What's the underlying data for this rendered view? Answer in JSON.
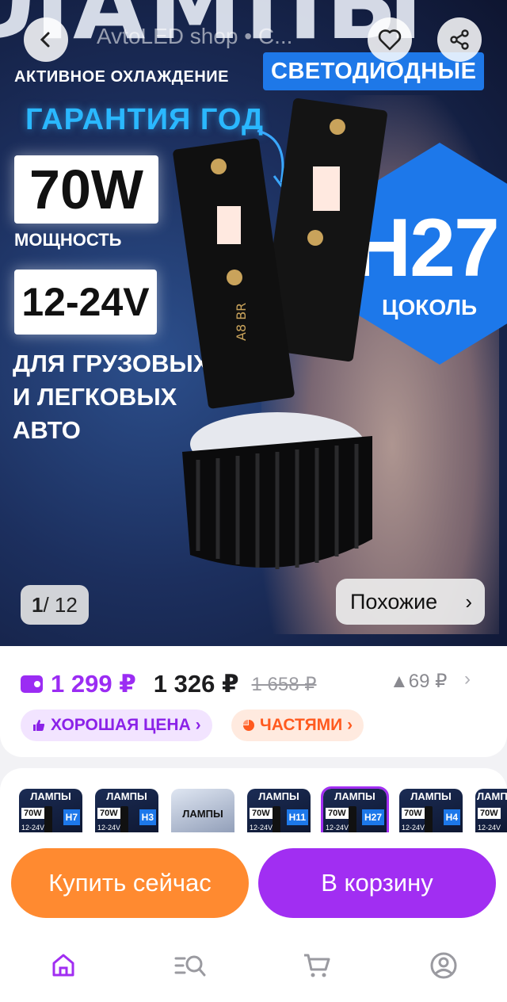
{
  "header": {
    "shop_name": "AvtoLED shop • С...",
    "back_icon": "back-arrow-icon",
    "favorite_icon": "heart-icon",
    "share_icon": "share-icon"
  },
  "hero": {
    "big_word": "ЛАМПЫ",
    "cooling": "АКТИВНОЕ ОХЛАЖДЕНИЕ",
    "led": "СВЕТОДИОДНЫЕ",
    "warranty": "ГАРАНТИЯ ГОД",
    "power_value": "70W",
    "power_label": "МОЩНОСТЬ",
    "voltage": "12-24V",
    "for_cars": "ДЛЯ ГРУЗОВЫХ И ЛЕГКОВЫХ АВТО",
    "base_code": "H27",
    "base_label": "ЦОКОЛЬ",
    "lamp_marking": "A8 BR",
    "image_index": "1",
    "image_total": "/ 12",
    "similar_label": "Похожие",
    "similar_chevron": "›"
  },
  "price": {
    "wallet_price": "1 299 ₽",
    "price": "1 326 ₽",
    "old_price": "1 658 ₽",
    "delta": "▲69 ₽",
    "chevron": "›"
  },
  "chips": {
    "good_price": "ХОРОШАЯ ЦЕНА ›",
    "installments": "ЧАСТЯМИ ›"
  },
  "variants": [
    {
      "title": "ЛАМПЫ",
      "power": "70W",
      "volt": "12-24V",
      "code": "H7"
    },
    {
      "title": "ЛАМПЫ",
      "power": "70W",
      "volt": "12-24V",
      "code": "H3"
    },
    {
      "title": "ЛАМПЫ",
      "power": "",
      "volt": "",
      "code": ""
    },
    {
      "title": "ЛАМПЫ",
      "power": "70W",
      "volt": "12-24V",
      "code": "H11"
    },
    {
      "title": "ЛАМПЫ",
      "power": "70W",
      "volt": "12-24V",
      "code": "H27"
    },
    {
      "title": "ЛАМПЫ",
      "power": "70W",
      "volt": "12-24V",
      "code": "H4"
    },
    {
      "title": "ЛАМПЫ",
      "power": "70W",
      "volt": "12-24V",
      "code": ""
    }
  ],
  "actions": {
    "buy_now": "Купить сейчас",
    "add_to_cart": "В корзину"
  },
  "nav": {
    "items": [
      "home-icon",
      "catalog-search-icon",
      "cart-icon",
      "profile-icon"
    ]
  },
  "colors": {
    "accent_purple": "#a12ef2",
    "buy_orange": "#ff8a30",
    "hero_blue": "#1d78ea"
  }
}
